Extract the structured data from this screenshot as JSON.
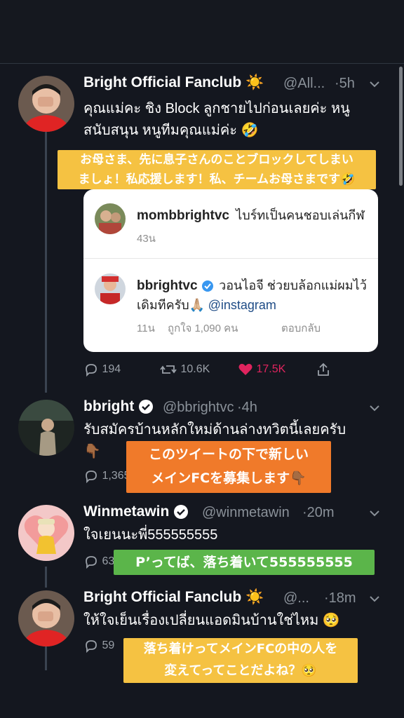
{
  "tweets": [
    {
      "name": "Bright Official Fanclub",
      "emoji": "☀️",
      "handle": "@All...",
      "time": "·5h",
      "text_line1": "คุณแม่คะ ชิง Block ลูกชายไปก่อนเลยค่ะ หนู",
      "text_line2": "สนับสนุน หนูทีมคุณแม่ค่ะ 🤣",
      "replies": "194",
      "retweets": "10.6K",
      "likes": "17.5K"
    },
    {
      "name": "bbright",
      "handle": "@bbrightvc",
      "time": "·4h",
      "text_line1": "รับสมัครบ้านหลักใหม่ด้านล่างทวิตนี้เลยครับ",
      "text_line2": "👇🏾",
      "replies": "1,365"
    },
    {
      "name": "Winmetawin",
      "handle": "@winmetawin",
      "time": "·20m",
      "text_line1": "ใจเยนนะพี่555555555",
      "replies": "63"
    },
    {
      "name": "Bright Official Fanclub",
      "emoji": "☀️",
      "handle": "@...",
      "time": "·18m",
      "text_line1": "ให้ใจเย็นเรื่องเปลี่ยนแอดมินบ้านใช่ไหม 🥺",
      "replies": "59"
    }
  ],
  "card": {
    "comment1": {
      "user": "mombbrightvc",
      "text": "ไบร์ทเป็นคนชอบเล่นกีฬ",
      "time": "43น"
    },
    "comment2": {
      "user": "bbrightvc",
      "text": "วอนไอจี ช่วยบล้อกแม่ผมไว้",
      "text2": "เดิมทีครับ🙏🏼",
      "mention": "@instagram",
      "time": "11น",
      "likes": "ถูกใจ 1,090 คน",
      "reply": "ตอบกลับ"
    }
  },
  "overlays": {
    "o1_line1": "お母さま、先に息子さんのことブロックしてしまい",
    "o1_line2": "ましょ！私応援します！私、チームお母さまです🤣",
    "o2_line1": "このツイートの下で新しい",
    "o2_line2": "メインFCを募集します👇🏾",
    "o3_line1": "P’ってば、落ち着いて555555555",
    "o4_line1": "落ち着けってメインFCの中の人を",
    "o4_line2": "変えてってことだよね？🥺"
  },
  "colors": {
    "background": "#14171f",
    "overlay_yellow": "#f5c242",
    "overlay_orange": "#f07a2a",
    "overlay_green": "#5bb54a",
    "like_pink": "#e0245e",
    "verified_blue": "#1da1f2"
  }
}
